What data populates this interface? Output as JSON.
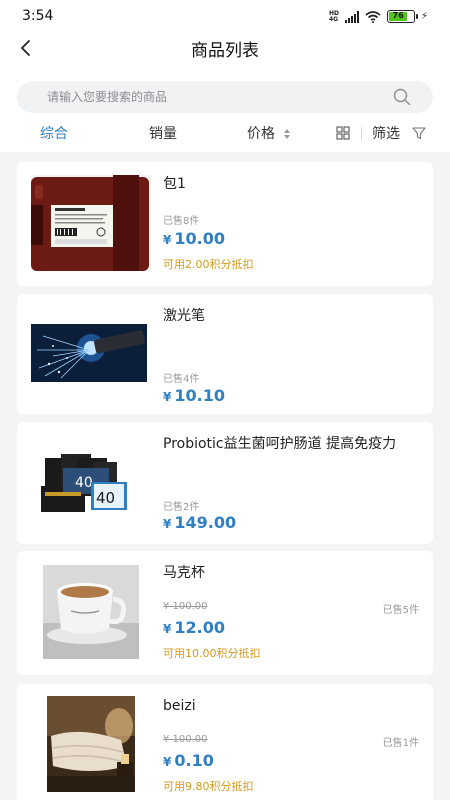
{
  "status_bar": {
    "time": "3:54",
    "battery": "76"
  },
  "header": {
    "title": "商品列表"
  },
  "search": {
    "placeholder": "请输入您要搜索的商品"
  },
  "sort_bar": {
    "items": [
      {
        "label": "综合",
        "active": true
      },
      {
        "label": "销量",
        "active": false
      },
      {
        "label": "价格",
        "active": false
      }
    ],
    "filter_label": "筛选"
  },
  "products": [
    {
      "name": "包1",
      "sold": "已售8件",
      "currency": "¥",
      "price": "10.00",
      "points": "可用2.00积分抵扣"
    },
    {
      "name": "激光笔",
      "sold": "已售4件",
      "currency": "¥",
      "price": "10.10"
    },
    {
      "name": "Probiotic益生菌呵护肠道 提高免疫力",
      "sold": "已售2件",
      "currency": "¥",
      "price": "149.00"
    },
    {
      "name": "马克杯",
      "original_price": "¥ 100.00",
      "sold": "已售5件",
      "currency": "¥",
      "price": "12.00",
      "points": "可用10.00积分抵扣"
    },
    {
      "name": "beizi",
      "original_price": "¥ 100.00",
      "sold": "已售1件",
      "currency": "¥",
      "price": "0.10",
      "points": "可用9.80积分抵扣"
    }
  ],
  "colors": {
    "accent": "#2f7fc1",
    "points": "#d49a1a",
    "background": "#f3f4f6"
  }
}
